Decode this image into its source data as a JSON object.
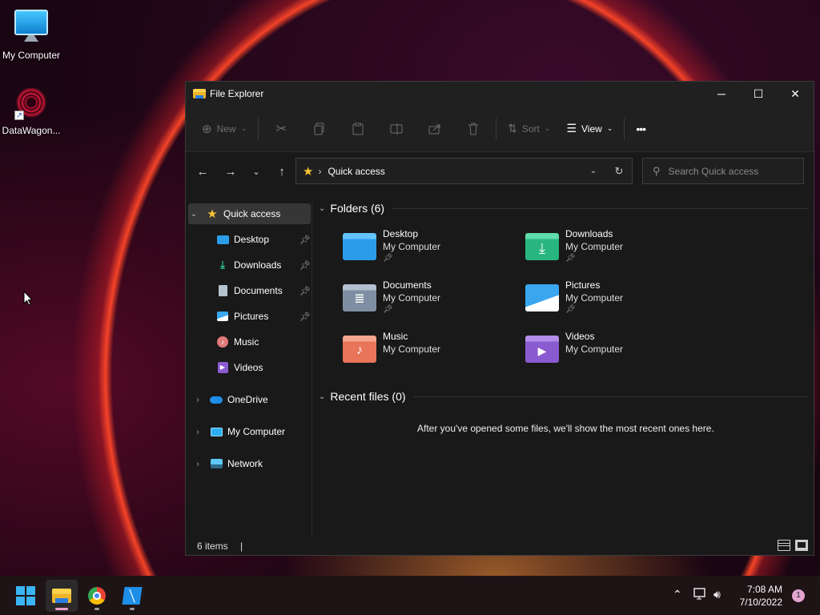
{
  "desktop": {
    "icons": [
      {
        "label": "My Computer"
      },
      {
        "label": "DataWagon..."
      }
    ]
  },
  "window": {
    "title": "File Explorer",
    "controls": {
      "minimize": "─",
      "maximize": "☐",
      "close": "✕"
    }
  },
  "toolbar": {
    "new_label": "New",
    "sort_label": "Sort",
    "view_label": "View",
    "more_label": "•••"
  },
  "address": {
    "path": "Quick access",
    "search_placeholder": "Search Quick access"
  },
  "sidebar": {
    "items": [
      {
        "label": "Quick access",
        "icon": "star-icon",
        "selected": true
      },
      {
        "label": "Desktop",
        "icon": "desktop-icon",
        "pinned": true
      },
      {
        "label": "Downloads",
        "icon": "download-icon",
        "pinned": true
      },
      {
        "label": "Documents",
        "icon": "document-icon",
        "pinned": true
      },
      {
        "label": "Pictures",
        "icon": "picture-icon",
        "pinned": true
      },
      {
        "label": "Music",
        "icon": "music-icon"
      },
      {
        "label": "Videos",
        "icon": "video-icon"
      },
      {
        "label": "OneDrive",
        "icon": "cloud-icon"
      },
      {
        "label": "My Computer",
        "icon": "computer-icon"
      },
      {
        "label": "Network",
        "icon": "network-icon"
      }
    ]
  },
  "content": {
    "folders_header": "Folders (6)",
    "folders": [
      {
        "name": "Desktop",
        "location": "My Computer",
        "pinned": true,
        "color": "#2b9de8"
      },
      {
        "name": "Downloads",
        "location": "My Computer",
        "pinned": true,
        "color": "#28b57f"
      },
      {
        "name": "Documents",
        "location": "My Computer",
        "pinned": true,
        "color": "#7f8fa3"
      },
      {
        "name": "Pictures",
        "location": "My Computer",
        "pinned": true,
        "color": "#1f8ee8"
      },
      {
        "name": "Music",
        "location": "My Computer",
        "pinned": false,
        "color": "#e8745a"
      },
      {
        "name": "Videos",
        "location": "My Computer",
        "pinned": false,
        "color": "#8a5ad0"
      }
    ],
    "recent_header": "Recent files (0)",
    "recent_empty": "After you've opened some files, we'll show the most recent ones here."
  },
  "status": {
    "items": "6 items"
  },
  "taskbar": {
    "apps": [
      "start-button",
      "file-explorer",
      "chrome",
      "datawagon"
    ],
    "clock_time": "7:08 AM",
    "clock_date": "7/10/2022",
    "notifications": "1"
  }
}
